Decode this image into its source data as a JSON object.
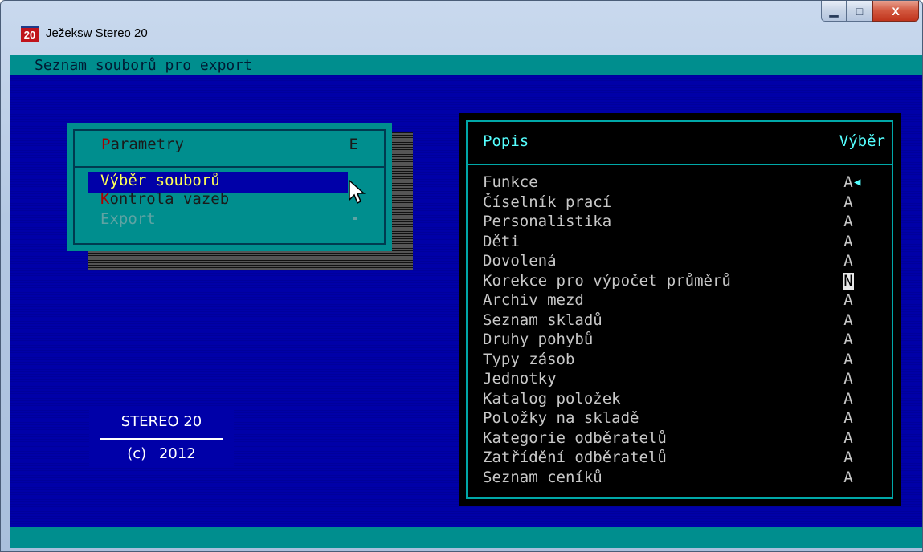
{
  "window": {
    "icon_text": "20",
    "title": "Ježeksw Stereo 20",
    "controls": {
      "minimize": "▁",
      "maximize": "□",
      "close": "X"
    }
  },
  "screen": {
    "header": "Seznam souborů pro export"
  },
  "menu": {
    "title_hotkey": "P",
    "title_rest": "arametry",
    "title_key": "E",
    "items": [
      {
        "label": "Výběr souborů",
        "state": "selected"
      },
      {
        "hotkey": "K",
        "rest": "ontrola vazeb",
        "state": "enabled"
      },
      {
        "label": "Export",
        "state": "disabled"
      }
    ]
  },
  "logo": {
    "line1": "STEREO 20",
    "line2": "(c) 2012"
  },
  "list": {
    "header_left": "Popis",
    "header_right": "Výběr",
    "rows": [
      {
        "label": "Funkce",
        "value": "A",
        "current": true
      },
      {
        "label": "Číselník prací",
        "value": "A"
      },
      {
        "label": "Personalistika",
        "value": "A"
      },
      {
        "label": "Děti",
        "value": "A"
      },
      {
        "label": "Dovolená",
        "value": "A"
      },
      {
        "label": "Korekce pro výpočet průměrů",
        "value": "N",
        "highlighted": true
      },
      {
        "label": "Archiv mezd",
        "value": "A"
      },
      {
        "label": "Seznam skladů",
        "value": "A"
      },
      {
        "label": "Druhy pohybů",
        "value": "A"
      },
      {
        "label": "Typy zásob",
        "value": "A"
      },
      {
        "label": "Jednotky",
        "value": "A"
      },
      {
        "label": "Katalog položek",
        "value": "A"
      },
      {
        "label": "Položky na skladě",
        "value": "A"
      },
      {
        "label": "Kategorie odběratelů",
        "value": "A"
      },
      {
        "label": "Zatřídění odběratelů",
        "value": "A"
      },
      {
        "label": "Seznam ceníků",
        "value": "A"
      }
    ]
  },
  "colors": {
    "background": "#0000a8",
    "bar": "#008e8e",
    "highlight_text": "#ffff55",
    "hotkey": "#a80000",
    "panel_accent": "#55ffff"
  }
}
